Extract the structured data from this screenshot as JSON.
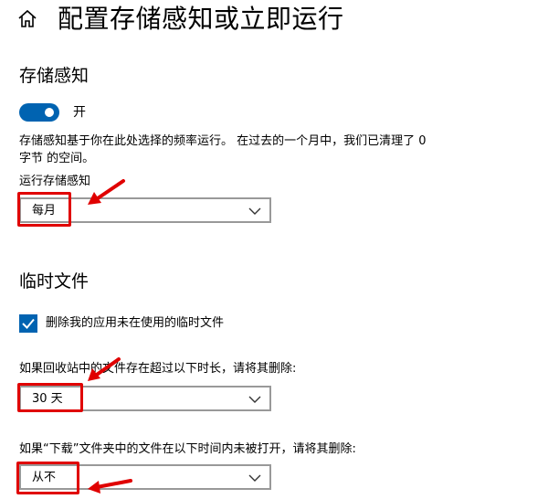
{
  "header": {
    "title": "配置存储感知或立即运行",
    "home_icon": "home-icon"
  },
  "storage_sense": {
    "section_title": "存储感知",
    "toggle_state": "on",
    "toggle_label": "开",
    "description": "存储感知基于你在此处选择的频率运行。 在过去的一个月中，我们已清理了 0 字节 的空间。",
    "run_label": "运行存储感知",
    "run_value": "每月"
  },
  "temp_files": {
    "section_title": "临时文件",
    "delete_temp_checked": true,
    "delete_temp_label": "删除我的应用未在使用的临时文件",
    "recycle_label": "如果回收站中的文件存在超过以下时长，请将其删除:",
    "recycle_value": "30 天",
    "downloads_label": "如果“下载”文件夹中的文件在以下时间内未被打开，请将其删除:",
    "downloads_value": "从不"
  },
  "colors": {
    "accent": "#0063b1",
    "annotation": "#e00000"
  }
}
